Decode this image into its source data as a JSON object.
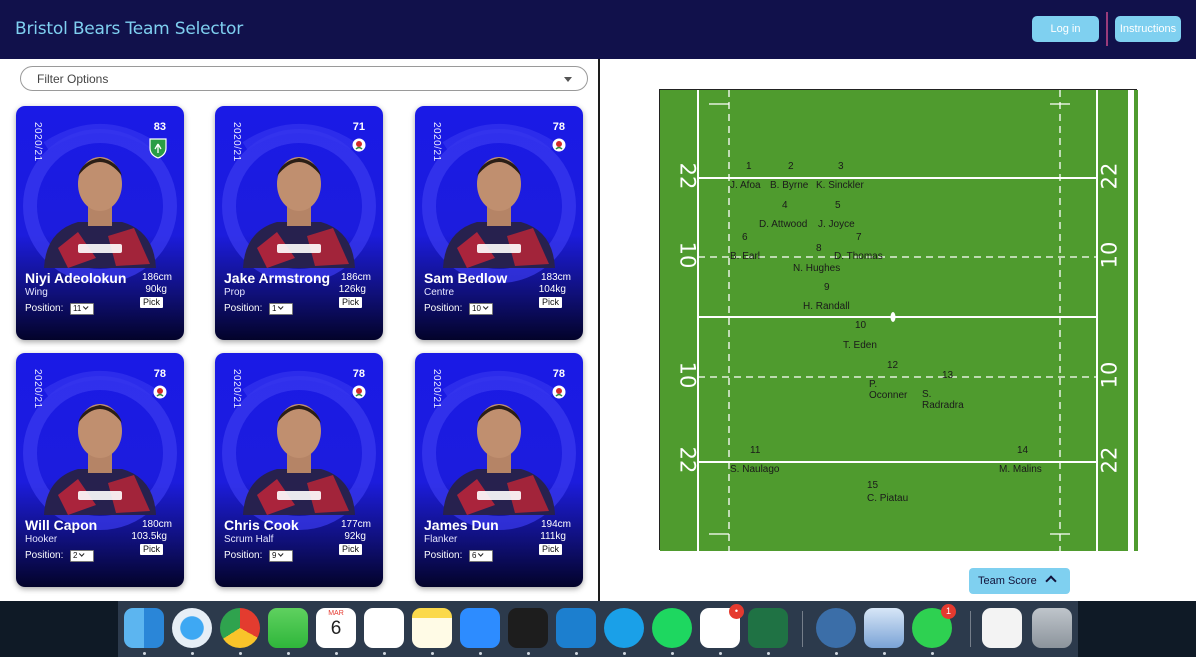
{
  "header": {
    "title": "Bristol Bears Team Selector",
    "login_label": "Log in",
    "instructions_label": "Instructions"
  },
  "filter": {
    "label": "Filter Options"
  },
  "cards": [
    {
      "season": "2020/21",
      "rating": "83",
      "flag": "ireland",
      "name": "Niyi Adeolokun",
      "role": "Wing",
      "height": "186cm",
      "weight": "90kg",
      "pick_label": "Pick",
      "position_label": "Position:",
      "position": "11"
    },
    {
      "season": "2020/21",
      "rating": "71",
      "flag": "england",
      "name": "Jake Armstrong",
      "role": "Prop",
      "height": "186cm",
      "weight": "126kg",
      "pick_label": "Pick",
      "position_label": "Position:",
      "position": "1"
    },
    {
      "season": "2020/21",
      "rating": "78",
      "flag": "england",
      "name": "Sam Bedlow",
      "role": "Centre",
      "height": "183cm",
      "weight": "104kg",
      "pick_label": "Pick",
      "position_label": "Position:",
      "position": "10"
    },
    {
      "season": "2020/21",
      "rating": "78",
      "flag": "england",
      "name": "Will Capon",
      "role": "Hooker",
      "height": "180cm",
      "weight": "103.5kg",
      "pick_label": "Pick",
      "position_label": "Position:",
      "position": "2"
    },
    {
      "season": "2020/21",
      "rating": "78",
      "flag": "england",
      "name": "Chris Cook",
      "role": "Scrum Half",
      "height": "177cm",
      "weight": "92kg",
      "pick_label": "Pick",
      "position_label": "Position:",
      "position": "9"
    },
    {
      "season": "2020/21",
      "rating": "78",
      "flag": "england",
      "name": "James Dun",
      "role": "Flanker",
      "height": "194cm",
      "weight": "111kg",
      "pick_label": "Pick",
      "position_label": "Position:",
      "position": "6"
    }
  ],
  "pitch": {
    "line_numbers": [
      "22",
      "10",
      "10",
      "22"
    ],
    "colors": {
      "grass": "#4f9b2e",
      "lines": "#ffffff"
    },
    "positions": [
      {
        "number": "1",
        "name": "J. Afoa"
      },
      {
        "number": "2",
        "name": "B. Byrne"
      },
      {
        "number": "3",
        "name": "K. Sinckler"
      },
      {
        "number": "4",
        "name": "D. Attwood"
      },
      {
        "number": "5",
        "name": "J. Joyce"
      },
      {
        "number": "6",
        "name": "B. Earl"
      },
      {
        "number": "7",
        "name": "D. Thomas"
      },
      {
        "number": "8",
        "name": "N. Hughes"
      },
      {
        "number": "9",
        "name": "H. Randall"
      },
      {
        "number": "10",
        "name": "T. Eden"
      },
      {
        "number": "12",
        "name": "P. Oconner"
      },
      {
        "number": "13",
        "name": "S. Radradra"
      },
      {
        "number": "11",
        "name": "S. Naulago"
      },
      {
        "number": "14",
        "name": "M. Malins"
      },
      {
        "number": "15",
        "name": "C. Piatau"
      }
    ]
  },
  "team_score": {
    "label": "Team Score"
  },
  "dock": {
    "calendar": {
      "month": "MAR",
      "day": "6"
    },
    "slack_badge": "•",
    "whatsapp_badge": "1",
    "icons": [
      "finder-icon",
      "safari-icon",
      "chrome-icon",
      "messages-icon",
      "calendar-icon",
      "reminders-icon",
      "notes-icon",
      "zoom-icon",
      "terminal-icon",
      "vscode-icon",
      "skype-icon",
      "spotify-icon",
      "slack-icon",
      "excel-icon",
      "mysql-workbench-icon",
      "preview-icon",
      "whatsapp-icon",
      "document-icon",
      "trash-icon"
    ]
  },
  "colors": {
    "header_bg": "#11114b",
    "accent": "#7fd0f0",
    "card_blue": "#1a1ae6"
  }
}
